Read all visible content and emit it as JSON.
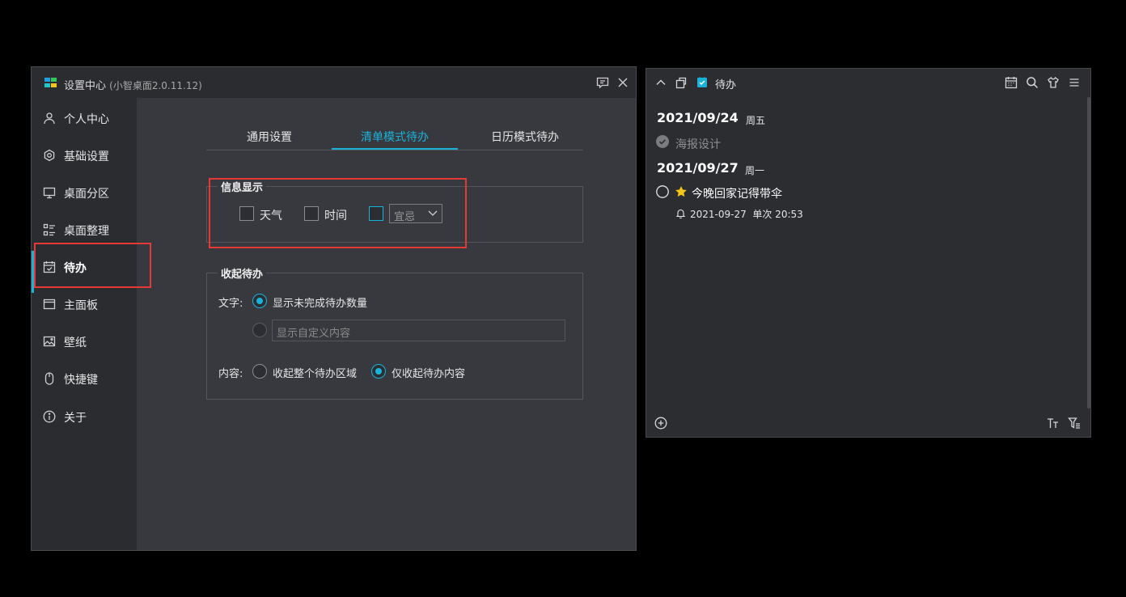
{
  "settings_window": {
    "title": "设置中心",
    "version": "(小智桌面2.0.11.12)",
    "sidebar": {
      "items": [
        {
          "label": "个人中心",
          "icon": "user-icon"
        },
        {
          "label": "基础设置",
          "icon": "gear-icon"
        },
        {
          "label": "桌面分区",
          "icon": "monitor-icon"
        },
        {
          "label": "桌面整理",
          "icon": "grid-list-icon"
        },
        {
          "label": "待办",
          "icon": "calendar-check-icon",
          "active": true
        },
        {
          "label": "主面板",
          "icon": "window-icon"
        },
        {
          "label": "壁纸",
          "icon": "image-icon"
        },
        {
          "label": "快捷键",
          "icon": "mouse-icon"
        },
        {
          "label": "关于",
          "icon": "info-icon"
        }
      ]
    },
    "tabs": [
      {
        "label": "通用设置"
      },
      {
        "label": "清单模式待办",
        "active": true
      },
      {
        "label": "日历模式待办"
      }
    ],
    "info_display": {
      "title": "信息显示",
      "weather_label": "天气",
      "weather_checked": false,
      "time_label": "时间",
      "time_checked": false,
      "almanac_checked": false,
      "almanac_select_value": "宜忌"
    },
    "collapse": {
      "title": "收起待办",
      "text_label": "文字:",
      "option_count": "显示未完成待办数量",
      "option_count_selected": true,
      "custom_placeholder": "显示自定义内容",
      "content_label": "内容:",
      "option_whole": "收起整个待办区域",
      "option_whole_selected": false,
      "option_content": "仅收起待办内容",
      "option_content_selected": true
    }
  },
  "todo_widget": {
    "title": "待办",
    "groups": [
      {
        "date": "2021/09/24",
        "weekday": "周五",
        "items": [
          {
            "text": "海报设计",
            "done": true
          }
        ]
      },
      {
        "date": "2021/09/27",
        "weekday": "周一",
        "items": [
          {
            "text": "今晚回家记得带伞",
            "done": false,
            "starred": true,
            "reminder": "2021-09-27  单次 20:53"
          }
        ]
      }
    ]
  },
  "colors": {
    "accent": "#19b3d9",
    "highlight_box": "#e53935",
    "star": "#f5c518"
  }
}
